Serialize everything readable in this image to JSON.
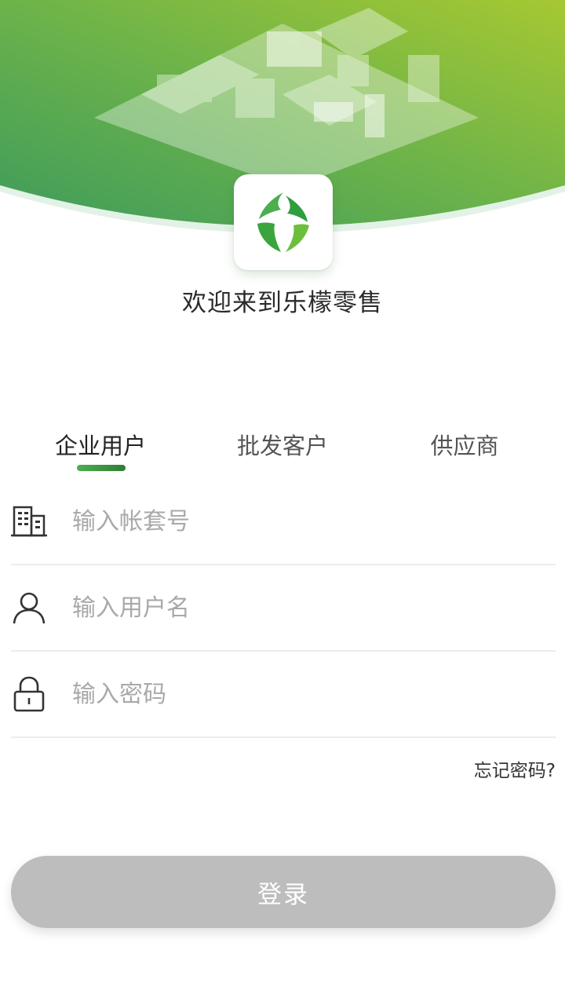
{
  "header": {
    "welcome_text": "欢迎来到乐檬零售",
    "gradient_start": "#3e9b5c",
    "gradient_end": "#9bc53a"
  },
  "tabs": [
    {
      "label": "企业用户",
      "active": true
    },
    {
      "label": "批发客户",
      "active": false
    },
    {
      "label": "供应商",
      "active": false
    }
  ],
  "form": {
    "account_placeholder": "输入帐套号",
    "username_placeholder": "输入用户名",
    "password_placeholder": "输入密码",
    "forgot_label": "忘记密码?",
    "login_label": "登录"
  },
  "icons": {
    "account": "building-icon",
    "username": "user-icon",
    "password": "lock-icon",
    "logo": "leaf-logo"
  },
  "colors": {
    "accent": "#4caf50",
    "button_disabled": "#bdbdbd"
  }
}
